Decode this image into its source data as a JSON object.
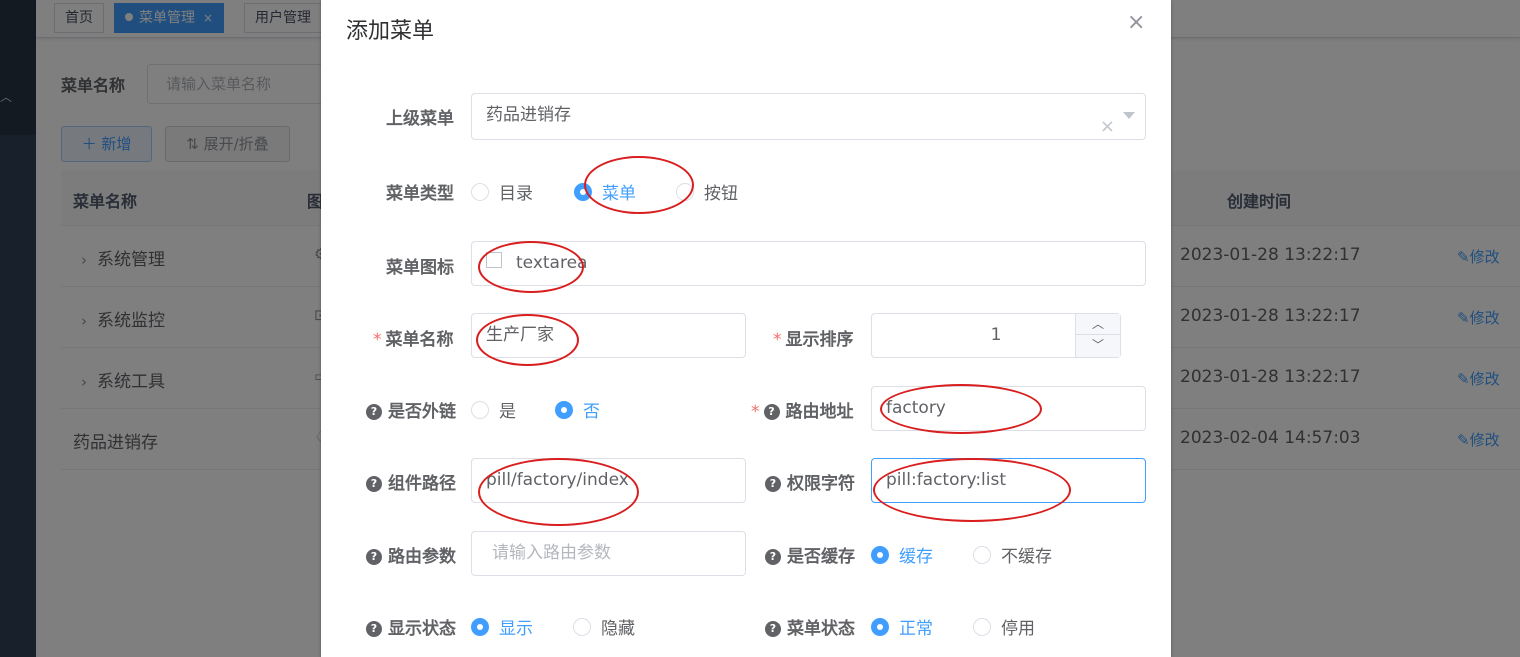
{
  "tags": {
    "home": "首页",
    "menu_mgmt": "菜单管理",
    "close": "×",
    "user_mgmt": "用户管理"
  },
  "search": {
    "label": "菜单名称",
    "placeholder": "请输入菜单名称"
  },
  "toolbar": {
    "add_label": "＋ 新增",
    "expand_label": "⇅ 展开/折叠"
  },
  "table": {
    "headers": [
      "菜单名称",
      "图",
      "创建时间"
    ],
    "rows": [
      {
        "name": "系统管理",
        "expandable": true,
        "icon_frag": "⚙",
        "time": "2023-01-28 13:22:17",
        "op": "修改"
      },
      {
        "name": "系统监控",
        "expandable": true,
        "icon_frag": "⊡",
        "time": "2023-01-28 13:22:17",
        "op": "修改"
      },
      {
        "name": "系统工具",
        "expandable": true,
        "icon_frag": "▭",
        "time": "2023-01-28 13:22:17",
        "op": "修改"
      },
      {
        "name": "药品进销存",
        "expandable": false,
        "icon_frag": "♢",
        "time": "2023-02-04 14:57:03",
        "op": "修改"
      }
    ]
  },
  "dialog": {
    "title": "添加菜单",
    "close": "×",
    "parent": {
      "label": "上级菜单",
      "value": "药品进销存",
      "clear": "×"
    },
    "type": {
      "label": "菜单类型",
      "options": [
        "目录",
        "菜单",
        "按钮"
      ],
      "selected": "菜单"
    },
    "icon": {
      "label": "菜单图标",
      "value": "textarea"
    },
    "name": {
      "label": "菜单名称",
      "required": "*",
      "value": "生产厂家"
    },
    "order": {
      "label": "显示排序",
      "required": "*",
      "value": "1",
      "up": "︿",
      "down": "﹀"
    },
    "external": {
      "label": "是否外链",
      "options": [
        "是",
        "否"
      ],
      "selected": "否"
    },
    "path": {
      "label": "路由地址",
      "required": "*",
      "value": "factory"
    },
    "component": {
      "label": "组件路径",
      "value": "pill/factory/index"
    },
    "perms": {
      "label": "权限字符",
      "value": "pill:factory:list"
    },
    "query": {
      "label": "路由参数",
      "placeholder": "请输入路由参数"
    },
    "cache": {
      "label": "是否缓存",
      "options": [
        "缓存",
        "不缓存"
      ],
      "selected": "缓存"
    },
    "visible": {
      "label": "显示状态",
      "options": [
        "显示",
        "隐藏"
      ],
      "selected": "显示"
    },
    "status": {
      "label": "菜单状态",
      "options": [
        "正常",
        "停用"
      ],
      "selected": "正常"
    }
  },
  "colors": {
    "primary": "#409eff",
    "annotation": "#d81e1e",
    "required": "#f56c6c",
    "sidebar": "#304156"
  }
}
